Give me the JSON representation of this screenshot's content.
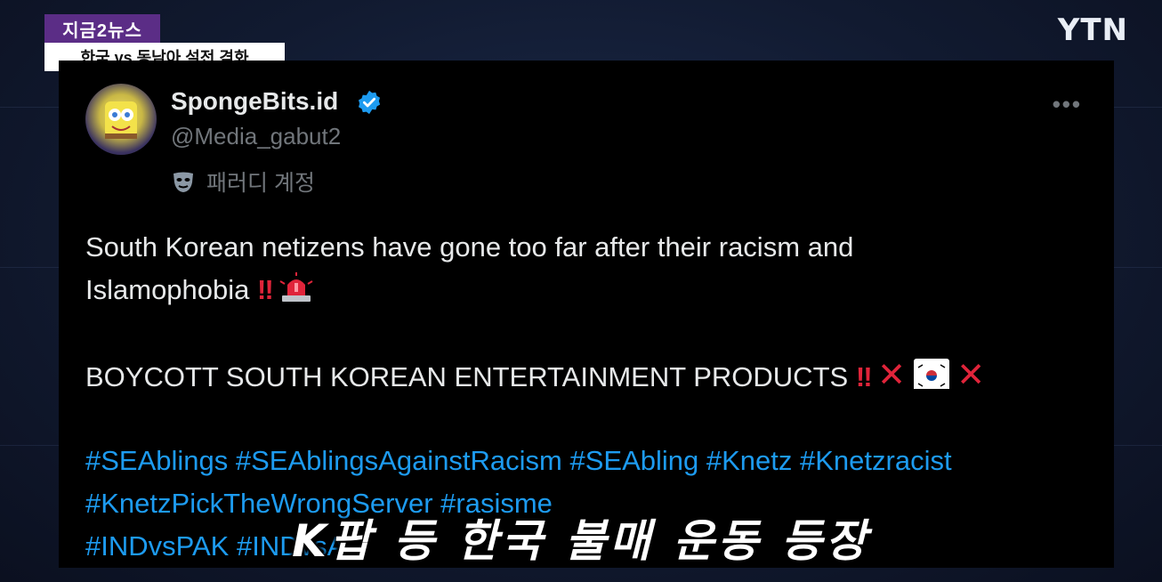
{
  "broadcast": {
    "program_badge": "지금2뉴스",
    "topic": "한국 vs 동남아 설전 격화",
    "channel_logo": "YTN",
    "caption": "K팝 등 한국 불매 운동 등장"
  },
  "tweet": {
    "display_name": "SpongeBits.id",
    "handle": "@Media_gabut2",
    "account_label": "패러디 계정",
    "more_label": "•••",
    "text_line1": "South Korean netizens have gone too far after their racism and",
    "text_line2": "Islamophobia",
    "boycott_text": "BOYCOTT SOUTH KOREAN ENTERTAINMENT PRODUCTS",
    "exclamation": "‼",
    "cross": "✕",
    "hashtags_line1": "#SEAblings #SEAblingsAgainstRacism #SEAbling #Knetz #Knetzracist",
    "hashtags_line2": "#KnetzPickTheWrongServer #rasisme",
    "hashtags_line3": "#INDvsPAK #INDvsA",
    "icons": {
      "avatar": "spongebob-avatar",
      "verified": "verified-badge-icon",
      "parody": "mask-icon",
      "more": "more-icon",
      "siren": "siren-emoji",
      "flag": "south-korea-flag-emoji"
    }
  },
  "colors": {
    "program_badge_bg": "#5b2d86",
    "hashtag": "#1d9bf0",
    "verified": "#1d9bf0",
    "alert_red": "#e0243a"
  }
}
